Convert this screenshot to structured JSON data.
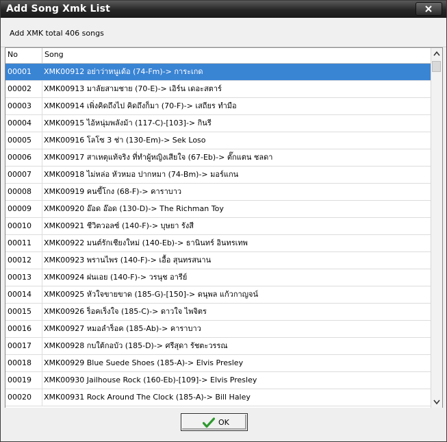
{
  "window": {
    "title": "Add Song Xmk List"
  },
  "info": {
    "text": "Add XMK total 406 songs"
  },
  "table": {
    "headers": {
      "no": "No",
      "song": "Song"
    },
    "rows": [
      {
        "no": "00001",
        "song": "XMK00912 อย่าว่าหนูเด้อ (74-Fm)-> การะเกด",
        "selected": true
      },
      {
        "no": "00002",
        "song": "XMK00913 มาลัยสามชาย (70-E)-> เอิร์น เดอะสตาร์"
      },
      {
        "no": "00003",
        "song": "XMK00914 เพิ่งคิดถึงไป คิดถึงก็มา (70-F)-> เสถียร ทำมือ"
      },
      {
        "no": "00004",
        "song": "XMK00915 ไอ้หนุ่มพลังม้า (117-C)-[103]-> กินรี"
      },
      {
        "no": "00005",
        "song": "XMK00916 โลโซ 3 ช่า (130-Em)-> Sek Loso"
      },
      {
        "no": "00006",
        "song": "XMK00917 สาเหตุแท้จริง ที่ทำผู้หญิงเสียใจ (67-Eb)-> ตั๊กแตน ชลดา"
      },
      {
        "no": "00007",
        "song": "XMK00918 ไม่หล่อ หัวหมอ ปากหมา (74-Bm)-> มอร์แกน"
      },
      {
        "no": "00008",
        "song": "XMK00919 คนขี้โกง (68-F)-> คาราบาว"
      },
      {
        "no": "00009",
        "song": "XMK00920 อ๊อด อ๊อด (130-D)-> The Richman Toy"
      },
      {
        "no": "00010",
        "song": "XMK00921 ชีวิตวอลซ์ (140-F)-> บุษยา รังสี"
      },
      {
        "no": "00011",
        "song": "XMK00922 มนต์รักเชียงใหม่ (140-Eb)-> ธานินทร์ อินทรเทพ"
      },
      {
        "no": "00012",
        "song": "XMK00923 พรานไพร (140-F)-> เอื้อ สุนทรสนาน"
      },
      {
        "no": "00013",
        "song": "XMK00924 ฝนเอย (140-F)-> วรนุช อารีย์"
      },
      {
        "no": "00014",
        "song": "XMK00925 หัวใจขายขาด (185-G)-[150]-> ดนุพล แก้วกาญจน์"
      },
      {
        "no": "00015",
        "song": "XMK00926 ร็อคเร็งใจ (185-C)-> ดาวใจ ไพจิตร"
      },
      {
        "no": "00016",
        "song": "XMK00927 หมอลำร็อค (185-Ab)-> คาราบาว"
      },
      {
        "no": "00017",
        "song": "XMK00928 กบใต้กอบัว (185-D)-> ศรีสุดา รัชตะวรรณ"
      },
      {
        "no": "00018",
        "song": "XMK00929 Blue Suede Shoes (185-A)-> Elvis Presley"
      },
      {
        "no": "00019",
        "song": "XMK00930 Jailhouse Rock (160-Eb)-[109]-> Elvis Presley"
      },
      {
        "no": "00020",
        "song": "XMK00931 Rock Around The Clock (185-A)-> Bill Haley"
      }
    ]
  },
  "footer": {
    "ok_label": "OK"
  },
  "icons": {
    "close": "close-icon",
    "ok": "checkmark-icon",
    "scroll_up": "scroll-up-arrow-icon",
    "scroll_down": "scroll-down-arrow-icon"
  },
  "colors": {
    "selection": "#3a84d4",
    "titlebar": "#262626",
    "ok_check": "#2e9a2e"
  }
}
